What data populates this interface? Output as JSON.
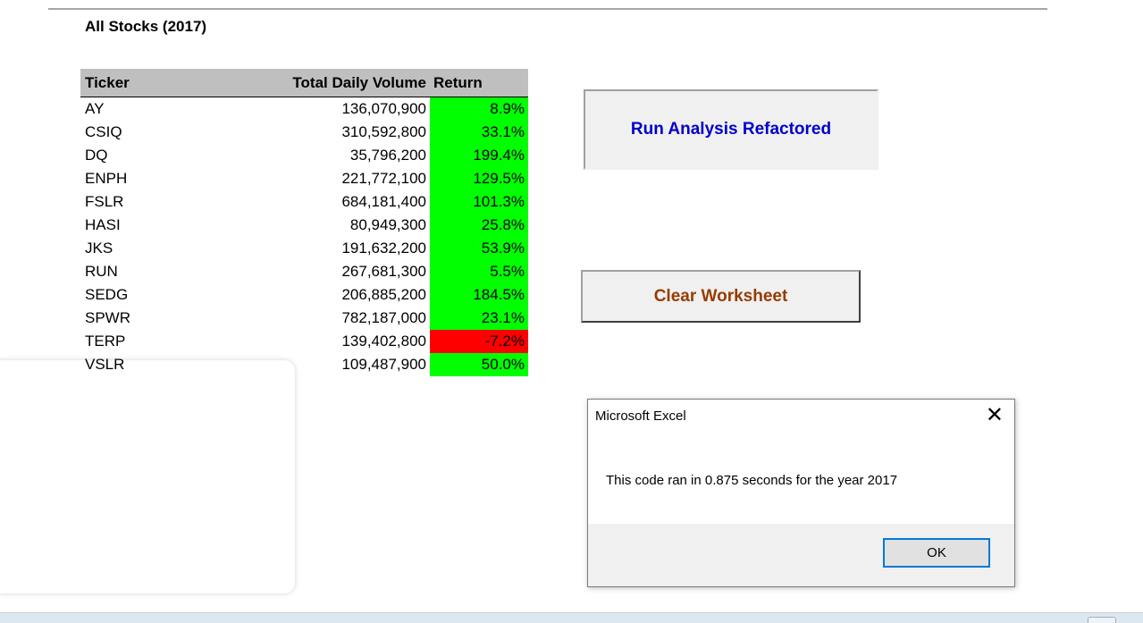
{
  "sheet": {
    "title": "All Stocks (2017)"
  },
  "table": {
    "headers": [
      "Ticker",
      "Total Daily Volume",
      "Return"
    ],
    "rows": [
      {
        "ticker": "AY",
        "volume": "136,070,900",
        "return": "8.9%",
        "status": "positive"
      },
      {
        "ticker": "CSIQ",
        "volume": "310,592,800",
        "return": "33.1%",
        "status": "positive"
      },
      {
        "ticker": "DQ",
        "volume": "35,796,200",
        "return": "199.4%",
        "status": "positive"
      },
      {
        "ticker": "ENPH",
        "volume": "221,772,100",
        "return": "129.5%",
        "status": "positive"
      },
      {
        "ticker": "FSLR",
        "volume": "684,181,400",
        "return": "101.3%",
        "status": "positive"
      },
      {
        "ticker": "HASI",
        "volume": "80,949,300",
        "return": "25.8%",
        "status": "positive"
      },
      {
        "ticker": "JKS",
        "volume": "191,632,200",
        "return": "53.9%",
        "status": "positive"
      },
      {
        "ticker": "RUN",
        "volume": "267,681,300",
        "return": "5.5%",
        "status": "positive"
      },
      {
        "ticker": "SEDG",
        "volume": "206,885,200",
        "return": "184.5%",
        "status": "positive"
      },
      {
        "ticker": "SPWR",
        "volume": "782,187,000",
        "return": "23.1%",
        "status": "positive"
      },
      {
        "ticker": "TERP",
        "volume": "139,402,800",
        "return": "-7.2%",
        "status": "negative"
      },
      {
        "ticker": "VSLR",
        "volume": "109,487,900",
        "return": "50.0%",
        "status": "positive"
      }
    ]
  },
  "buttons": {
    "run_label": "Run Analysis Refactored",
    "clear_label": "Clear Worksheet"
  },
  "dialog": {
    "title": "Microsoft Excel",
    "close_glyph": "✕",
    "message": "This code ran in 0.875 seconds for the year 2017",
    "ok_label": "OK"
  },
  "colors": {
    "positive": "#00ff00",
    "negative": "#ff0000",
    "header_bg": "#bfbfbf",
    "run_text": "#0000cc",
    "clear_text": "#963c00"
  }
}
